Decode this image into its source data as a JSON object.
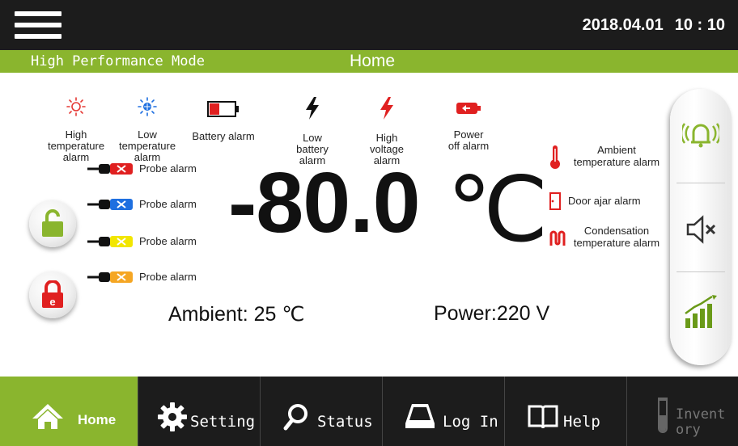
{
  "header": {
    "date": "2018.04.01",
    "time": "10 : 10"
  },
  "mode": {
    "label": "High Performance Mode",
    "page_title": "Home"
  },
  "alarms_top": [
    {
      "icon": "sun-icon",
      "color": "#e53935",
      "label": "High\ntemperature\nalarm"
    },
    {
      "icon": "snowflake-sun-icon",
      "color": "#1e6fe0",
      "label": "Low\ntemperature\nalarm"
    },
    {
      "icon": "battery-icon",
      "color": "#e02020",
      "label": "Battery alarm"
    },
    {
      "icon": "lightning-icon",
      "color": "#111111",
      "label": "Low\nbattery\nalarm"
    },
    {
      "icon": "lightning-icon",
      "color": "#e02020",
      "label": "High\nvoltage\nalarm"
    },
    {
      "icon": "power-plug-icon",
      "color": "#e02020",
      "label": "Power\noff alarm"
    }
  ],
  "probes": [
    {
      "label": "Probe alarm",
      "color": "#e02020"
    },
    {
      "label": "Probe alarm",
      "color": "#1e6fe0"
    },
    {
      "label": "Probe alarm",
      "color": "#f2e600"
    },
    {
      "label": "Probe alarm",
      "color": "#f5a623"
    }
  ],
  "temperature": {
    "value": "-80.0",
    "unit": "℃"
  },
  "ambient": {
    "label": "Ambient:",
    "value": "25",
    "unit": "℃"
  },
  "power": {
    "label": "Power:",
    "value": "220",
    "unit": "V"
  },
  "side_alarms": [
    {
      "icon": "thermometer-icon",
      "label": "Ambient\ntemperature alarm"
    },
    {
      "icon": "door-icon",
      "label": "Door ajar alarm"
    },
    {
      "icon": "condensation-icon",
      "label": "Condensation\ntemperature alarm"
    }
  ],
  "right_panel": {
    "buttons": [
      "alarm-bell-icon",
      "mute-icon",
      "growth-chart-icon"
    ]
  },
  "nav": [
    {
      "label": "Home",
      "icon": "home-icon",
      "active": true
    },
    {
      "label": "Setting",
      "icon": "gear-icon"
    },
    {
      "label": "Status",
      "icon": "search-icon"
    },
    {
      "label": "Log In",
      "icon": "login-icon"
    },
    {
      "label": "Help",
      "icon": "book-icon"
    },
    {
      "label": "Invent\nory",
      "icon": "test-tube-icon",
      "disabled": true
    }
  ],
  "colors": {
    "accent": "#8ab52e",
    "bar": "#1c1c1c",
    "alarm_red": "#e02020",
    "alarm_blue": "#1e6fe0"
  }
}
